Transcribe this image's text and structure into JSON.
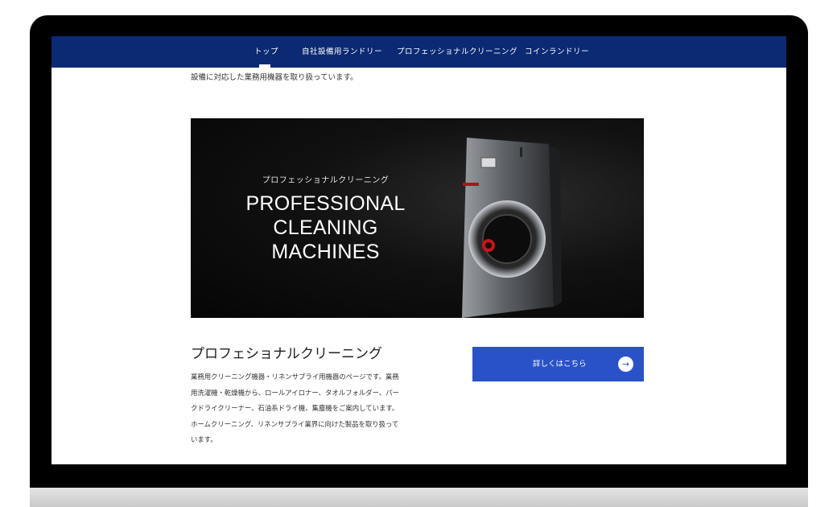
{
  "nav": {
    "items": [
      {
        "label": "トップ"
      },
      {
        "label": "自社設備用ランドリー"
      },
      {
        "label": "プロフェッショナルクリーニング"
      },
      {
        "label": "コインランドリー"
      }
    ],
    "active_index": 0
  },
  "intro": {
    "text": "設備に対応した業務用機器を取り扱っています。"
  },
  "hero": {
    "subtitle": "プロフェッショナルクリーニング",
    "title_lines": [
      "PROFESSIONAL",
      "CLEANING",
      "MACHINES"
    ]
  },
  "section": {
    "title": "プロフェショナルクリーニング",
    "body_lines": [
      "業務用クリーニング機器・リネンサプライ用機器のページです。業務",
      "用洗濯機・乾燥機から、ロールアイロナー、タオルフォルダー、パー",
      "クドライクリーナー、石油系ドライ機、集塵機をご案内しています。",
      "ホームクリーニング、リネンサプライ業界に向けた製品を取り扱って",
      "います。"
    ]
  },
  "cta": {
    "label": "詳しくはこちら",
    "icon": "arrow-right-icon"
  },
  "colors": {
    "nav_bg": "#0b2a73",
    "cta_bg": "#2952c9",
    "hero_bg": "#0a0a0a"
  }
}
